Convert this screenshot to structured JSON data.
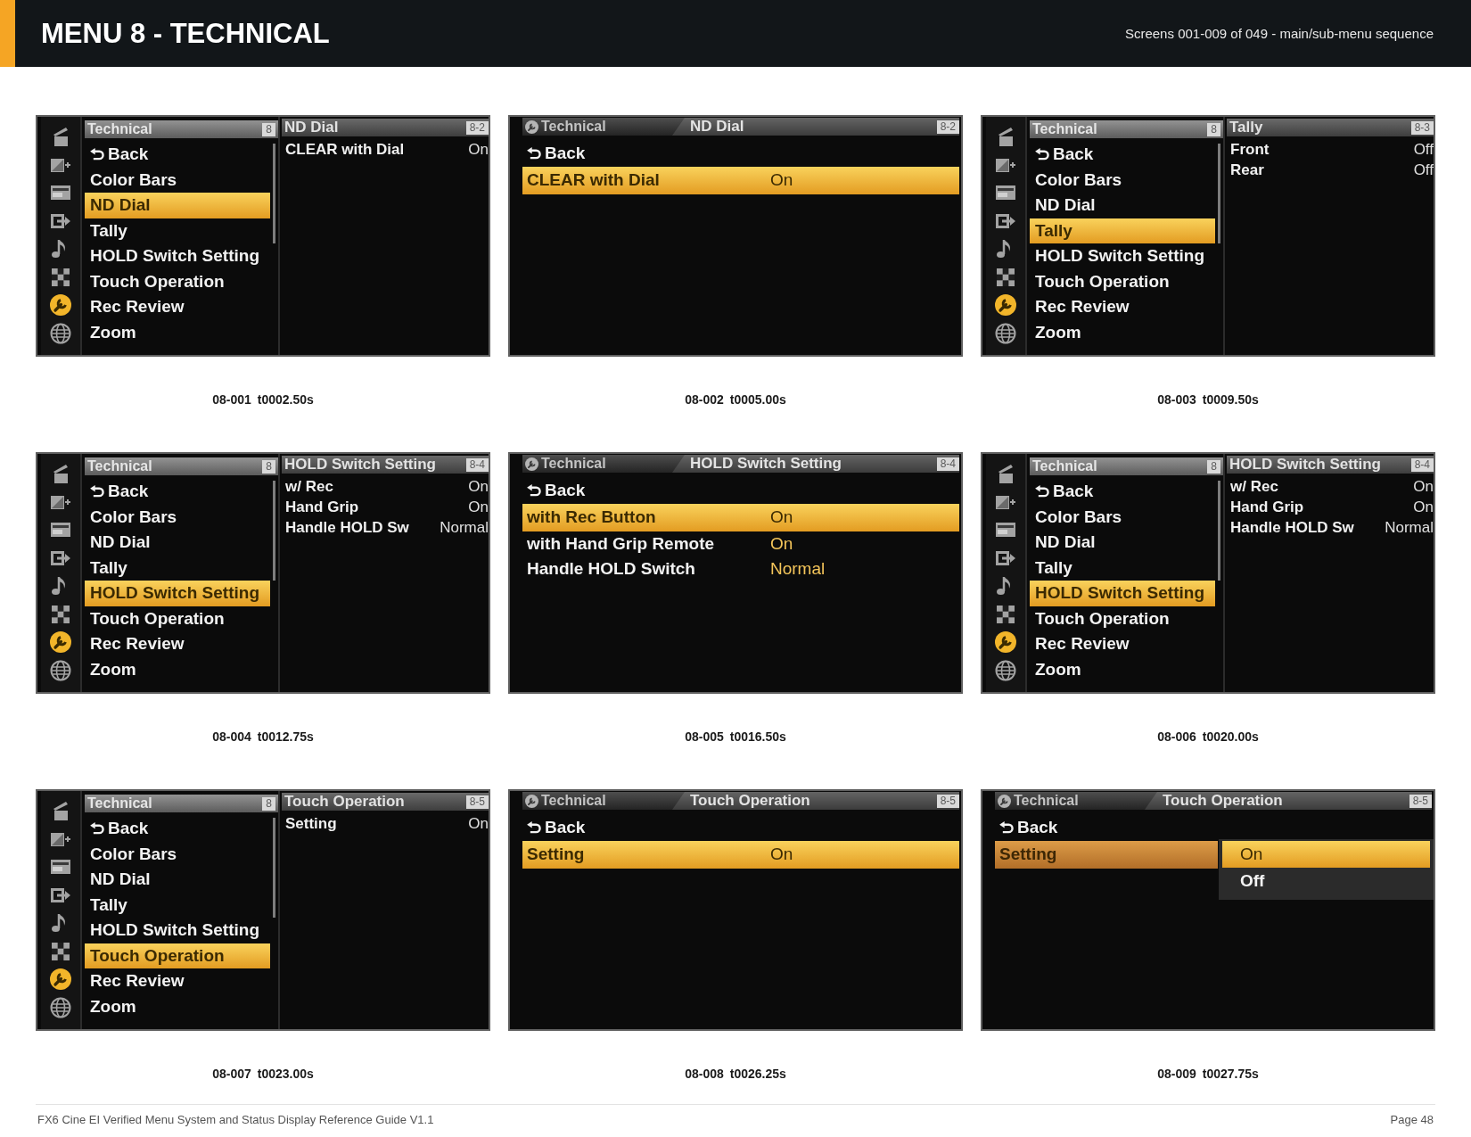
{
  "header": {
    "title": "MENU 8 - TECHNICAL",
    "subtitle": "Screens 001-009 of 049 - main/sub-menu sequence"
  },
  "screens": [
    {
      "kind": "main",
      "caption": {
        "id": "08-001",
        "time": "t0002.50s"
      },
      "categories": [
        {
          "selected": false
        },
        {
          "selected": false
        },
        {
          "selected": false
        },
        {
          "selected": false
        },
        {
          "selected": false
        },
        {
          "selected": false
        },
        {
          "selected": true
        },
        {
          "selected": false
        }
      ],
      "menu": {
        "title": "Technical",
        "badge": "8",
        "items": [
          {
            "kind": "back",
            "label": "Back",
            "selected": false
          },
          {
            "kind": "item",
            "label": "Color Bars",
            "selected": false
          },
          {
            "kind": "item",
            "label": "ND Dial",
            "selected": true
          },
          {
            "kind": "item",
            "label": "Tally",
            "selected": false
          },
          {
            "kind": "item",
            "label": "HOLD Switch Setting",
            "selected": false
          },
          {
            "kind": "item",
            "label": "Touch Operation",
            "selected": false
          },
          {
            "kind": "item",
            "label": "Rec Review",
            "selected": false
          },
          {
            "kind": "item",
            "label": "Zoom",
            "selected": false
          }
        ]
      },
      "panel": {
        "title": "ND Dial",
        "badge": "8-2",
        "rows": [
          {
            "label": "CLEAR with Dial",
            "value": "On"
          }
        ]
      }
    },
    {
      "kind": "sub",
      "caption": {
        "id": "08-002",
        "time": "t0005.00s"
      },
      "breadcrumb": "Technical",
      "title": "ND Dial",
      "badge": "8-2",
      "rows": [
        {
          "kind": "back",
          "label": "Back",
          "selected": false
        },
        {
          "kind": "setting",
          "label": "CLEAR with Dial",
          "value": "On",
          "selected": true
        }
      ]
    },
    {
      "kind": "main",
      "caption": {
        "id": "08-003",
        "time": "t0009.50s"
      },
      "categories": [
        {
          "selected": false
        },
        {
          "selected": false
        },
        {
          "selected": false
        },
        {
          "selected": false
        },
        {
          "selected": false
        },
        {
          "selected": false
        },
        {
          "selected": true
        },
        {
          "selected": false
        }
      ],
      "menu": {
        "title": "Technical",
        "badge": "8",
        "items": [
          {
            "kind": "back",
            "label": "Back",
            "selected": false
          },
          {
            "kind": "item",
            "label": "Color Bars",
            "selected": false
          },
          {
            "kind": "item",
            "label": "ND Dial",
            "selected": false
          },
          {
            "kind": "item",
            "label": "Tally",
            "selected": true
          },
          {
            "kind": "item",
            "label": "HOLD Switch Setting",
            "selected": false
          },
          {
            "kind": "item",
            "label": "Touch Operation",
            "selected": false
          },
          {
            "kind": "item",
            "label": "Rec Review",
            "selected": false
          },
          {
            "kind": "item",
            "label": "Zoom",
            "selected": false
          }
        ]
      },
      "panel": {
        "title": "Tally",
        "badge": "8-3",
        "rows": [
          {
            "label": "Front",
            "value": "Off"
          },
          {
            "label": "Rear",
            "value": "Off"
          }
        ]
      }
    },
    {
      "kind": "main",
      "caption": {
        "id": "08-004",
        "time": "t0012.75s"
      },
      "categories": [
        {
          "selected": false
        },
        {
          "selected": false
        },
        {
          "selected": false
        },
        {
          "selected": false
        },
        {
          "selected": false
        },
        {
          "selected": false
        },
        {
          "selected": true
        },
        {
          "selected": false
        }
      ],
      "menu": {
        "title": "Technical",
        "badge": "8",
        "items": [
          {
            "kind": "back",
            "label": "Back",
            "selected": false
          },
          {
            "kind": "item",
            "label": "Color Bars",
            "selected": false
          },
          {
            "kind": "item",
            "label": "ND Dial",
            "selected": false
          },
          {
            "kind": "item",
            "label": "Tally",
            "selected": false
          },
          {
            "kind": "item",
            "label": "HOLD Switch Setting",
            "selected": true
          },
          {
            "kind": "item",
            "label": "Touch Operation",
            "selected": false
          },
          {
            "kind": "item",
            "label": "Rec Review",
            "selected": false
          },
          {
            "kind": "item",
            "label": "Zoom",
            "selected": false
          }
        ]
      },
      "panel": {
        "title": "HOLD Switch Setting",
        "badge": "8-4",
        "rows": [
          {
            "label": "w/ Rec",
            "value": "On"
          },
          {
            "label": "Hand Grip",
            "value": "On"
          },
          {
            "label": "Handle HOLD Sw",
            "value": "Normal"
          }
        ]
      }
    },
    {
      "kind": "sub",
      "caption": {
        "id": "08-005",
        "time": "t0016.50s"
      },
      "breadcrumb": "Technical",
      "title": "HOLD Switch Setting",
      "badge": "8-4",
      "rows": [
        {
          "kind": "back",
          "label": "Back",
          "selected": false
        },
        {
          "kind": "setting",
          "label": "with Rec Button",
          "value": "On",
          "selected": true
        },
        {
          "kind": "setting",
          "label": "with Hand Grip Remote",
          "value": "On",
          "selected": false
        },
        {
          "kind": "setting",
          "label": "Handle HOLD Switch",
          "value": "Normal",
          "selected": false
        }
      ]
    },
    {
      "kind": "main",
      "caption": {
        "id": "08-006",
        "time": "t0020.00s"
      },
      "categories": [
        {
          "selected": false
        },
        {
          "selected": false
        },
        {
          "selected": false
        },
        {
          "selected": false
        },
        {
          "selected": false
        },
        {
          "selected": false
        },
        {
          "selected": true
        },
        {
          "selected": false
        }
      ],
      "menu": {
        "title": "Technical",
        "badge": "8",
        "items": [
          {
            "kind": "back",
            "label": "Back",
            "selected": false
          },
          {
            "kind": "item",
            "label": "Color Bars",
            "selected": false
          },
          {
            "kind": "item",
            "label": "ND Dial",
            "selected": false
          },
          {
            "kind": "item",
            "label": "Tally",
            "selected": false
          },
          {
            "kind": "item",
            "label": "HOLD Switch Setting",
            "selected": true
          },
          {
            "kind": "item",
            "label": "Touch Operation",
            "selected": false
          },
          {
            "kind": "item",
            "label": "Rec Review",
            "selected": false
          },
          {
            "kind": "item",
            "label": "Zoom",
            "selected": false
          }
        ]
      },
      "panel": {
        "title": "HOLD Switch Setting",
        "badge": "8-4",
        "rows": [
          {
            "label": "w/ Rec",
            "value": "On"
          },
          {
            "label": "Hand Grip",
            "value": "On"
          },
          {
            "label": "Handle HOLD Sw",
            "value": "Normal"
          }
        ]
      }
    },
    {
      "kind": "main",
      "caption": {
        "id": "08-007",
        "time": "t0023.00s"
      },
      "categories": [
        {
          "selected": false
        },
        {
          "selected": false
        },
        {
          "selected": false
        },
        {
          "selected": false
        },
        {
          "selected": false
        },
        {
          "selected": false
        },
        {
          "selected": true
        },
        {
          "selected": false
        }
      ],
      "menu": {
        "title": "Technical",
        "badge": "8",
        "items": [
          {
            "kind": "back",
            "label": "Back",
            "selected": false
          },
          {
            "kind": "item",
            "label": "Color Bars",
            "selected": false
          },
          {
            "kind": "item",
            "label": "ND Dial",
            "selected": false
          },
          {
            "kind": "item",
            "label": "Tally",
            "selected": false
          },
          {
            "kind": "item",
            "label": "HOLD Switch Setting",
            "selected": false
          },
          {
            "kind": "item",
            "label": "Touch Operation",
            "selected": true
          },
          {
            "kind": "item",
            "label": "Rec Review",
            "selected": false
          },
          {
            "kind": "item",
            "label": "Zoom",
            "selected": false
          }
        ]
      },
      "panel": {
        "title": "Touch Operation",
        "badge": "8-5",
        "rows": [
          {
            "label": "Setting",
            "value": "On"
          }
        ]
      }
    },
    {
      "kind": "sub",
      "caption": {
        "id": "08-008",
        "time": "t0026.25s"
      },
      "breadcrumb": "Technical",
      "title": "Touch Operation",
      "badge": "8-5",
      "rows": [
        {
          "kind": "back",
          "label": "Back",
          "selected": false
        },
        {
          "kind": "setting",
          "label": "Setting",
          "value": "On",
          "selected": true
        }
      ]
    },
    {
      "kind": "sub",
      "caption": {
        "id": "08-009",
        "time": "t0027.75s"
      },
      "breadcrumb": "Technical",
      "title": "Touch Operation",
      "badge": "8-5",
      "rows": [
        {
          "kind": "back",
          "label": "Back",
          "selected": false
        },
        {
          "kind": "setting",
          "label": "Setting",
          "selected": true
        }
      ],
      "popup": [
        {
          "label": "On",
          "selected": true
        },
        {
          "label": "Off",
          "selected": false
        }
      ]
    }
  ],
  "footer": {
    "text": "FX6 Cine EI Verified Menu System and Status Display Reference Guide V1.1",
    "page": "Page 48"
  }
}
